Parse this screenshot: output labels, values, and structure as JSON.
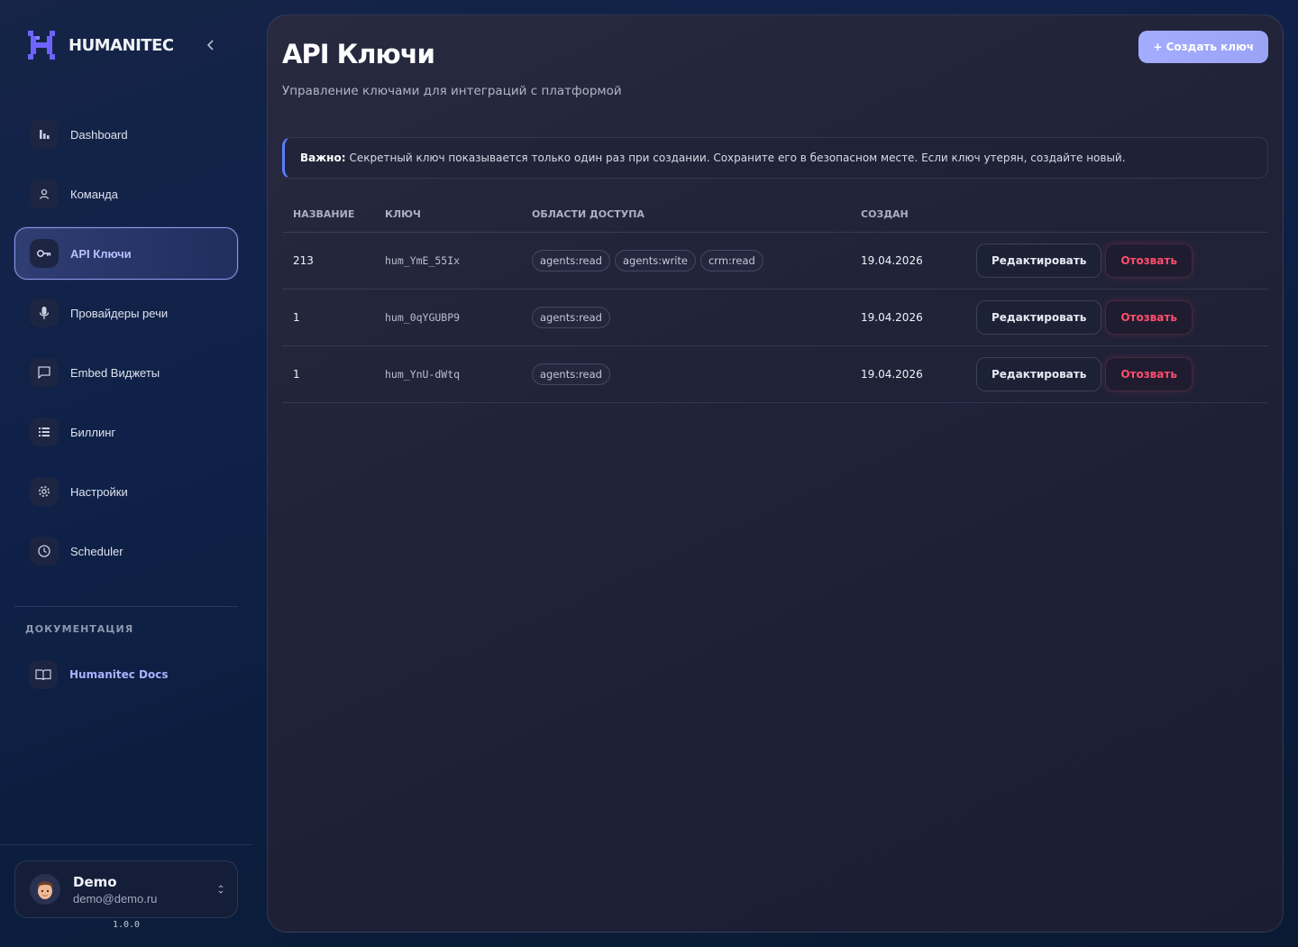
{
  "brand": {
    "name": "HUMANITEC"
  },
  "sidebar": {
    "items": [
      {
        "label": "Dashboard",
        "icon": "bar-chart-icon"
      },
      {
        "label": "Команда",
        "icon": "user-icon"
      },
      {
        "label": "API Ключи",
        "icon": "key-icon",
        "active": true
      },
      {
        "label": "Провайдеры речи",
        "icon": "microphone-icon"
      },
      {
        "label": "Embed Виджеты",
        "icon": "chat-bubble-icon"
      },
      {
        "label": "Биллинг",
        "icon": "list-icon"
      },
      {
        "label": "Настройки",
        "icon": "gear-icon"
      },
      {
        "label": "Scheduler",
        "icon": "clock-icon"
      }
    ],
    "docs_heading": "ДОКУМЕНТАЦИЯ",
    "docs_item": {
      "label": "Humanitec Docs",
      "icon": "book-icon"
    }
  },
  "user": {
    "name": "Demo",
    "email": "demo@demo.ru"
  },
  "version": "1.0.0",
  "page": {
    "title": "API Ключи",
    "subtitle": "Управление ключами для интеграций с платформой",
    "create_button": "+ Создать ключ"
  },
  "notice": {
    "label": "Важно:",
    "text": "Секретный ключ показывается только один раз при создании. Сохраните его в безопасном месте. Если ключ утерян, создайте новый."
  },
  "table": {
    "columns": [
      "НАЗВАНИЕ",
      "КЛЮЧ",
      "ОБЛАСТИ ДОСТУПА",
      "СОЗДАН"
    ],
    "edit_label": "Редактировать",
    "revoke_label": "Отозвать",
    "rows": [
      {
        "name": "213",
        "key": "hum_YmE_55Ix",
        "scopes": [
          "agents:read",
          "agents:write",
          "crm:read"
        ],
        "created": "19.04.2026"
      },
      {
        "name": "1",
        "key": "hum_0qYGUBP9",
        "scopes": [
          "agents:read"
        ],
        "created": "19.04.2026"
      },
      {
        "name": "1",
        "key": "hum_YnU-dWtq",
        "scopes": [
          "agents:read"
        ],
        "created": "19.04.2026"
      }
    ]
  },
  "colors": {
    "accent": "#8d97e8",
    "danger": "#ff4d6d",
    "primary_button": "#a3acff"
  }
}
